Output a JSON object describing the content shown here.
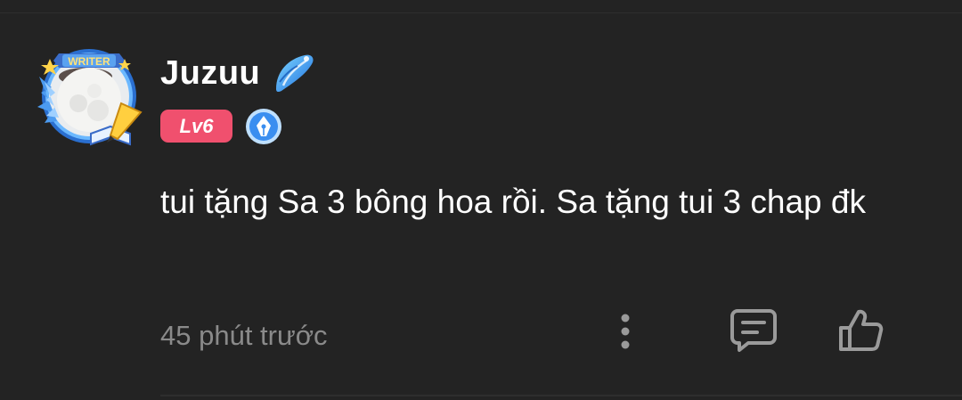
{
  "comment": {
    "username": "Juzuu",
    "avatar_frame_label": "WRITER",
    "level_badge": "Lv6",
    "text": "tui tặng Sa 3 bông hoa rồi. Sa tặng tui 3 chap đk",
    "timestamp": "45 phút trước",
    "icons": {
      "user_badge": "shell-icon",
      "writer_badge": "pen-nib-icon",
      "more": "more-vertical-icon",
      "reply": "comment-icon",
      "like": "thumbs-up-icon"
    },
    "colors": {
      "background": "#232323",
      "level_badge": "#f0506e",
      "timestamp": "#8a8a8a",
      "icon": "#9a9a9a",
      "frame_blue": "#3a8ef0"
    }
  }
}
